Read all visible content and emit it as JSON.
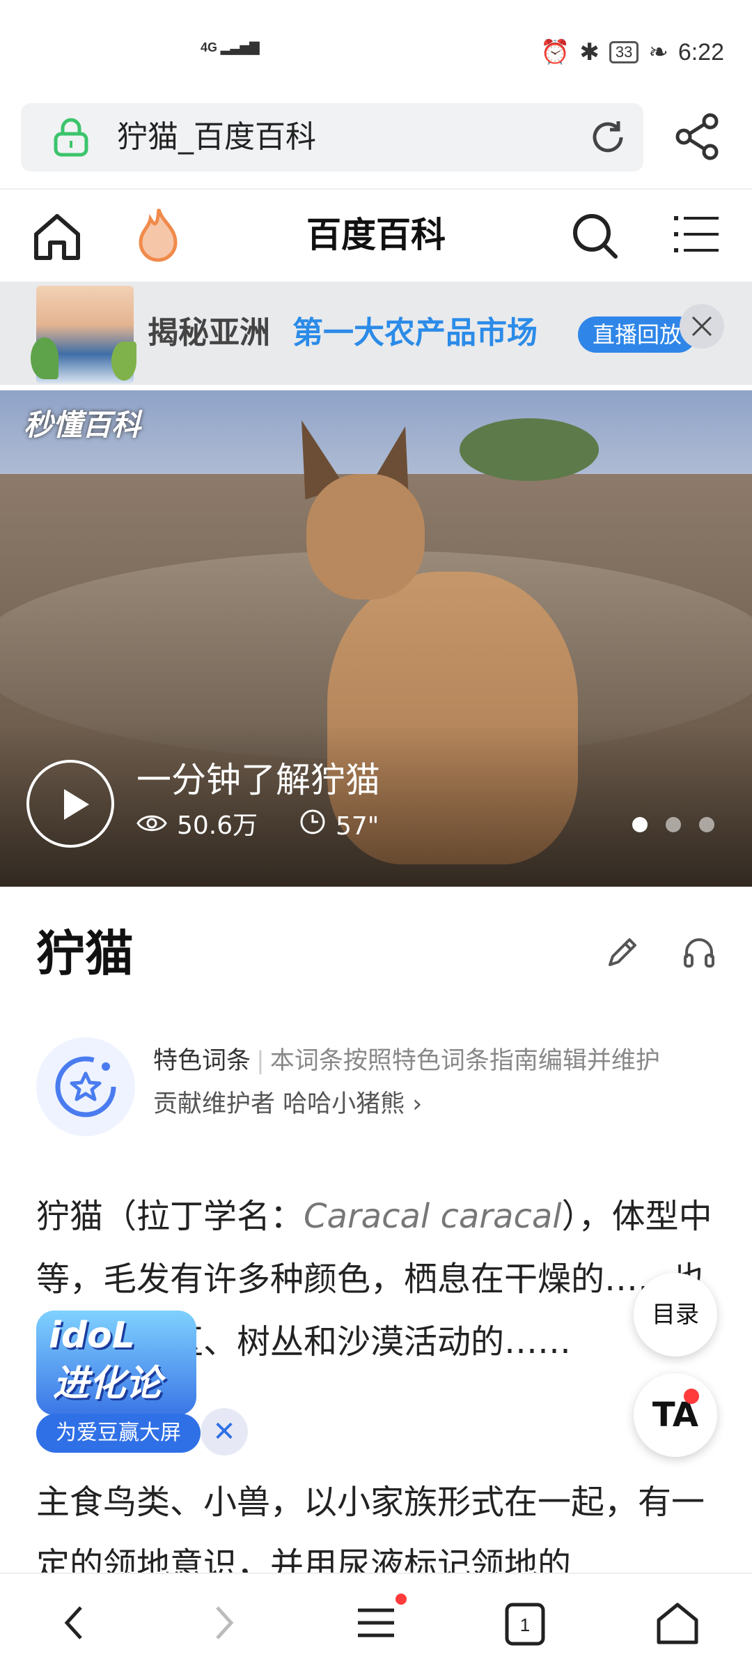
{
  "status_bar": {
    "network": "4G",
    "battery": "33",
    "time": "6:22"
  },
  "url_bar": {
    "title": "狞猫_百度百科"
  },
  "nav": {
    "brand": "百度百科"
  },
  "banner": {
    "text_dark": "揭秘亚洲",
    "text_blue": "第一大农产品市场",
    "pill": "直播回放"
  },
  "hero": {
    "logo": "秒懂百科",
    "video_title": "一分钟了解狞猫",
    "views": "50.6万",
    "duration": "57\""
  },
  "entry": {
    "title": "狞猫",
    "feature_label": "特色词条",
    "feature_desc": "本词条按照特色词条指南编辑并维护",
    "contributor": "贡献维护者 哈哈小猪熊 ›"
  },
  "body": {
    "p1_a": "狞猫（拉丁学名：",
    "p1_latin": "Caracal caracal",
    "p1_b": "），体型中等，毛发有许多种颜色，栖息在干燥的……也有其在山区、树丛和沙漠活动的……",
    "p2": "主食鸟类、小兽，以小家族形式在一起，有一定的领地意识，并用尿液标记领地的"
  },
  "floating": {
    "toc": "目录",
    "ta": "TA"
  },
  "promo": {
    "line1": "idoL",
    "line2": "进化论",
    "label": "为爱豆赢大屏",
    "close": "✕"
  },
  "bottom_nav": {
    "tabs_count": "1"
  },
  "colors": {
    "accent_blue": "#2f86e8",
    "lock_green": "#3cc46b",
    "flame_orange": "#f08a4b"
  }
}
